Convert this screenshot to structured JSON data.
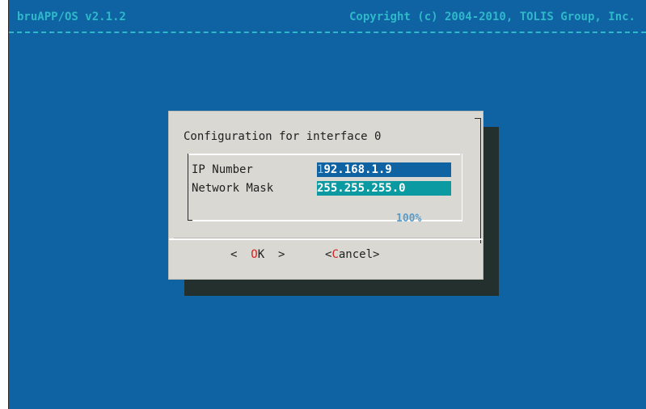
{
  "header": {
    "app_title": "bruAPP/OS v2.1.2",
    "copyright": "Copyright (c) 2004-2010, TOLIS Group, Inc."
  },
  "dialog": {
    "title": "Configuration for interface 0",
    "fields": [
      {
        "label": "IP Number",
        "value_first_char": "1",
        "value_rest": "92.168.1.9"
      },
      {
        "label": "Network Mask",
        "value": "255.255.255.0"
      }
    ],
    "scroll_percent": "100%",
    "ok_button": {
      "left": "<  ",
      "hotkey": "O",
      "rest": "K  >"
    },
    "cancel_button": {
      "left": "<",
      "hotkey": "C",
      "rest": "ancel>"
    }
  },
  "colors": {
    "background": "#0f63a3",
    "header_text": "#2fb8c9",
    "dialog_bg": "#d9d8d2",
    "shadow": "#24302d",
    "selected_field_bg": "#0b9aa2",
    "hotkey": "#d81f1f"
  }
}
